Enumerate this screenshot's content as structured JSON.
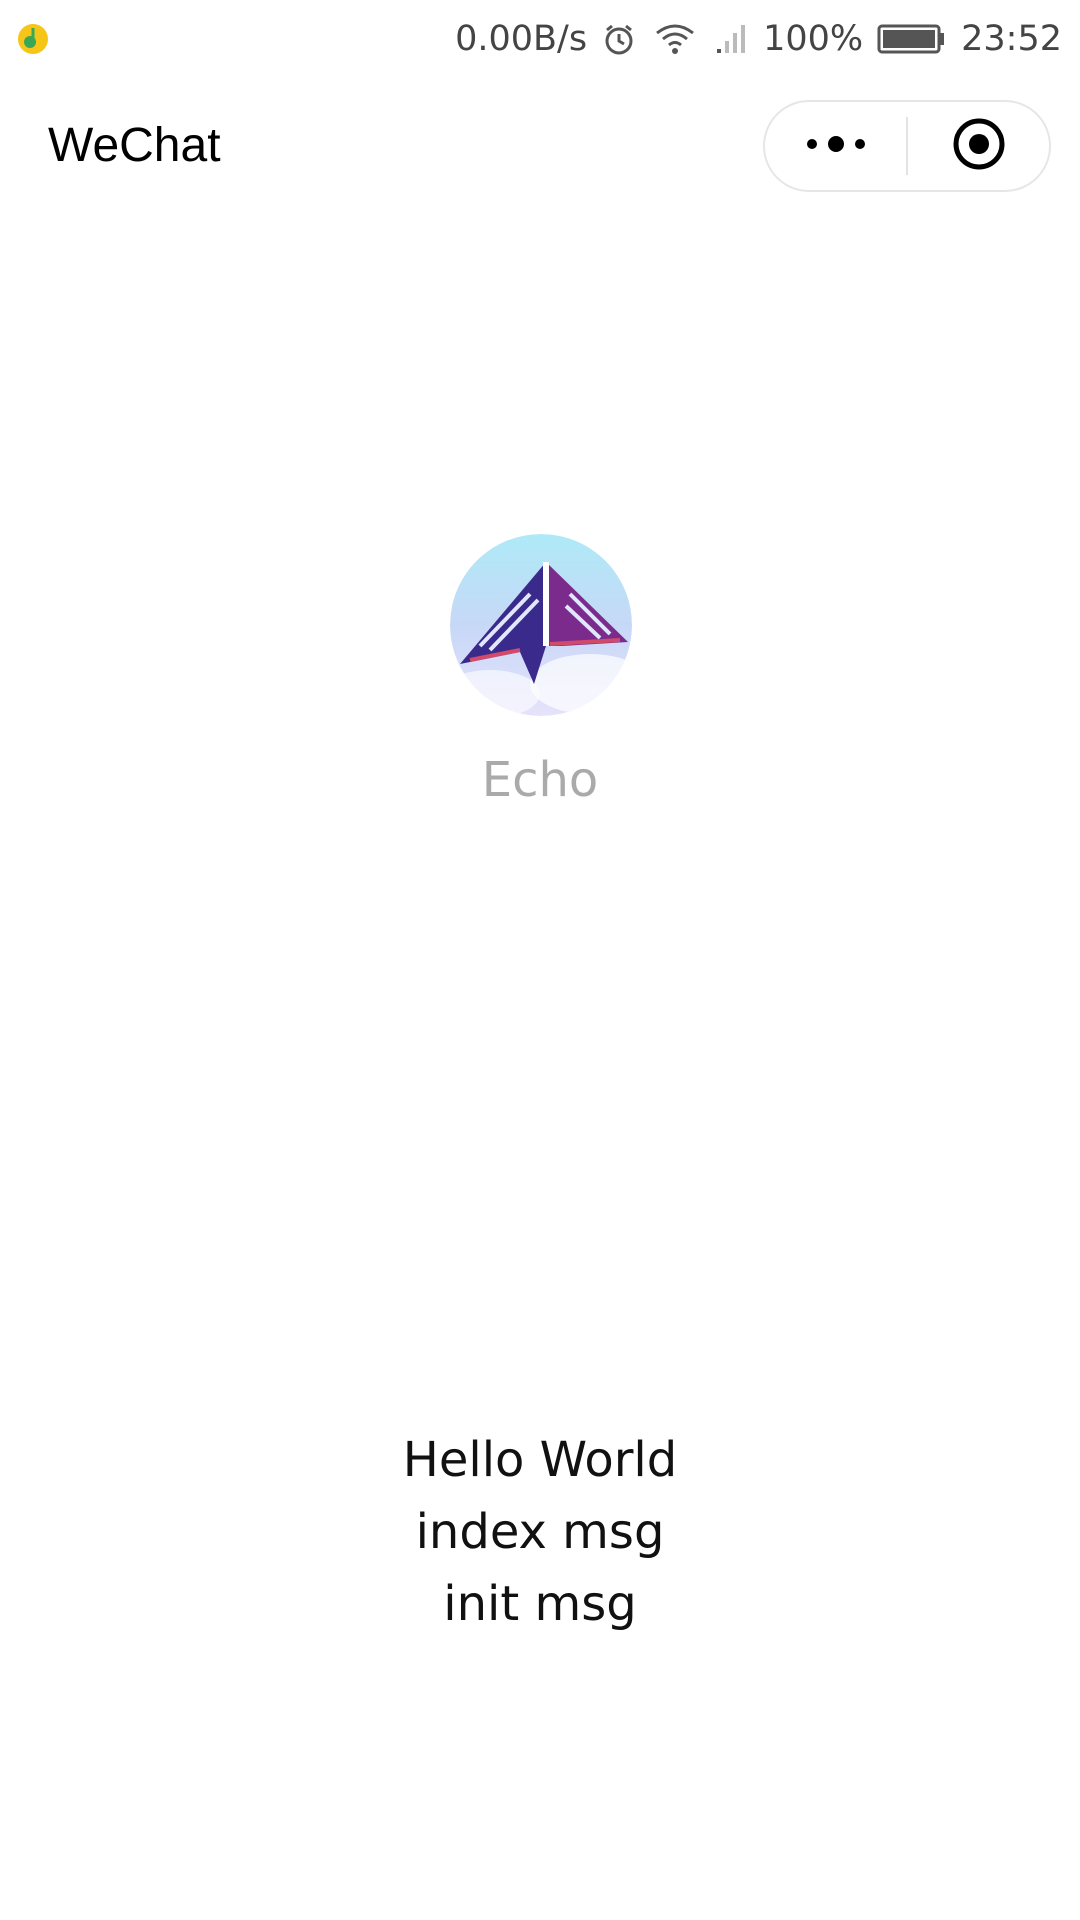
{
  "status_bar": {
    "network_speed": "0.00B/s",
    "battery": "100%",
    "time": "23:52",
    "icons": [
      "app-notification-icon",
      "alarm-icon",
      "wifi-icon",
      "signal-icon",
      "battery-icon"
    ]
  },
  "header": {
    "title": "WeChat",
    "capsule": {
      "more_icon": "more-dots-icon",
      "close_icon": "target-close-icon"
    }
  },
  "profile": {
    "avatar_icon": "paper-kite-avatar",
    "nickname": "Echo"
  },
  "messages": [
    "Hello World",
    "index msg",
    "init msg"
  ],
  "colors": {
    "background": "#ffffff",
    "nickname": "#aaaaaa",
    "text": "#111111",
    "capsule_border": "#e6e6e6"
  }
}
